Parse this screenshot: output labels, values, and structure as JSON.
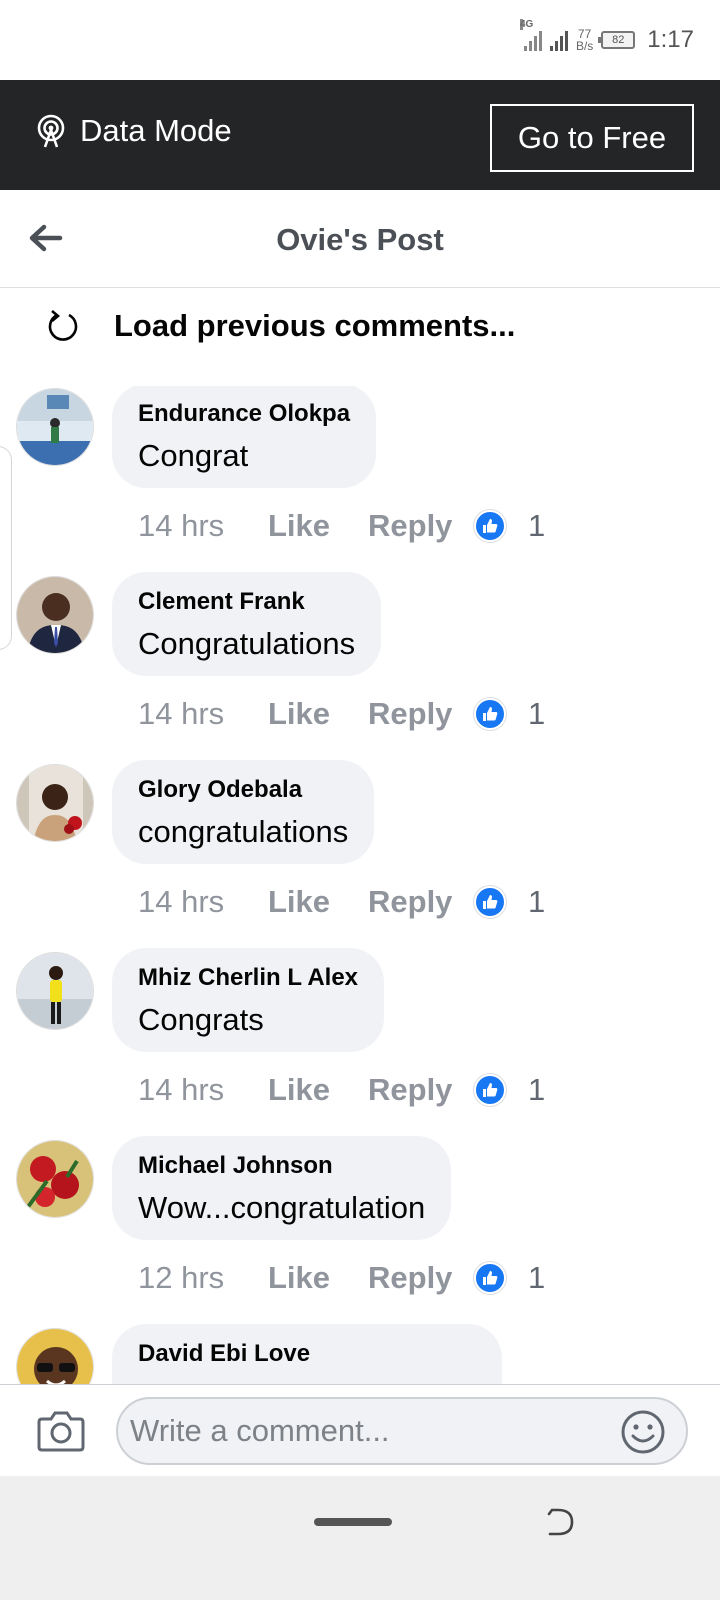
{
  "status_bar": {
    "network": "4G",
    "speed_value": "77",
    "speed_unit": "B/s",
    "battery": "82",
    "time": "1:17"
  },
  "data_bar": {
    "label": "Data Mode",
    "go_free_label": "Go to Free",
    "background": "#242526"
  },
  "header": {
    "title": "Ovie's Post"
  },
  "load_previous": "Load previous comments...",
  "comments": [
    {
      "author": "Endurance Olokpa",
      "text": "Congrat",
      "time": "14 hrs",
      "like": "Like",
      "reply": "Reply",
      "reactions": "1"
    },
    {
      "author": "Clement Frank",
      "text": "Congratulations",
      "time": "14 hrs",
      "like": "Like",
      "reply": "Reply",
      "reactions": "1"
    },
    {
      "author": "Glory Odebala",
      "text": "congratulations",
      "time": "14 hrs",
      "like": "Like",
      "reply": "Reply",
      "reactions": "1"
    },
    {
      "author": "Mhiz Cherlin L Alex",
      "text": "Congrats",
      "time": "14 hrs",
      "like": "Like",
      "reply": "Reply",
      "reactions": "1"
    },
    {
      "author": "Michael Johnson",
      "text": "Wow...congratulation",
      "time": "12 hrs",
      "like": "Like",
      "reply": "Reply",
      "reactions": "1"
    },
    {
      "author": "David Ebi Love",
      "text": "",
      "time": "",
      "like": "",
      "reply": "",
      "reactions": ""
    }
  ],
  "composer": {
    "placeholder": "Write a comment..."
  },
  "colors": {
    "accent_blue": "#1877f2",
    "bubble_bg": "#f0f2f5",
    "meta_gray": "#90949c"
  },
  "icons": {
    "data_mode": "broadcast-icon",
    "back": "arrow-left-icon",
    "load_previous": "refresh-icon",
    "like_reaction": "thumbs-up-icon",
    "camera": "camera-icon",
    "emoji": "smiley-icon"
  }
}
